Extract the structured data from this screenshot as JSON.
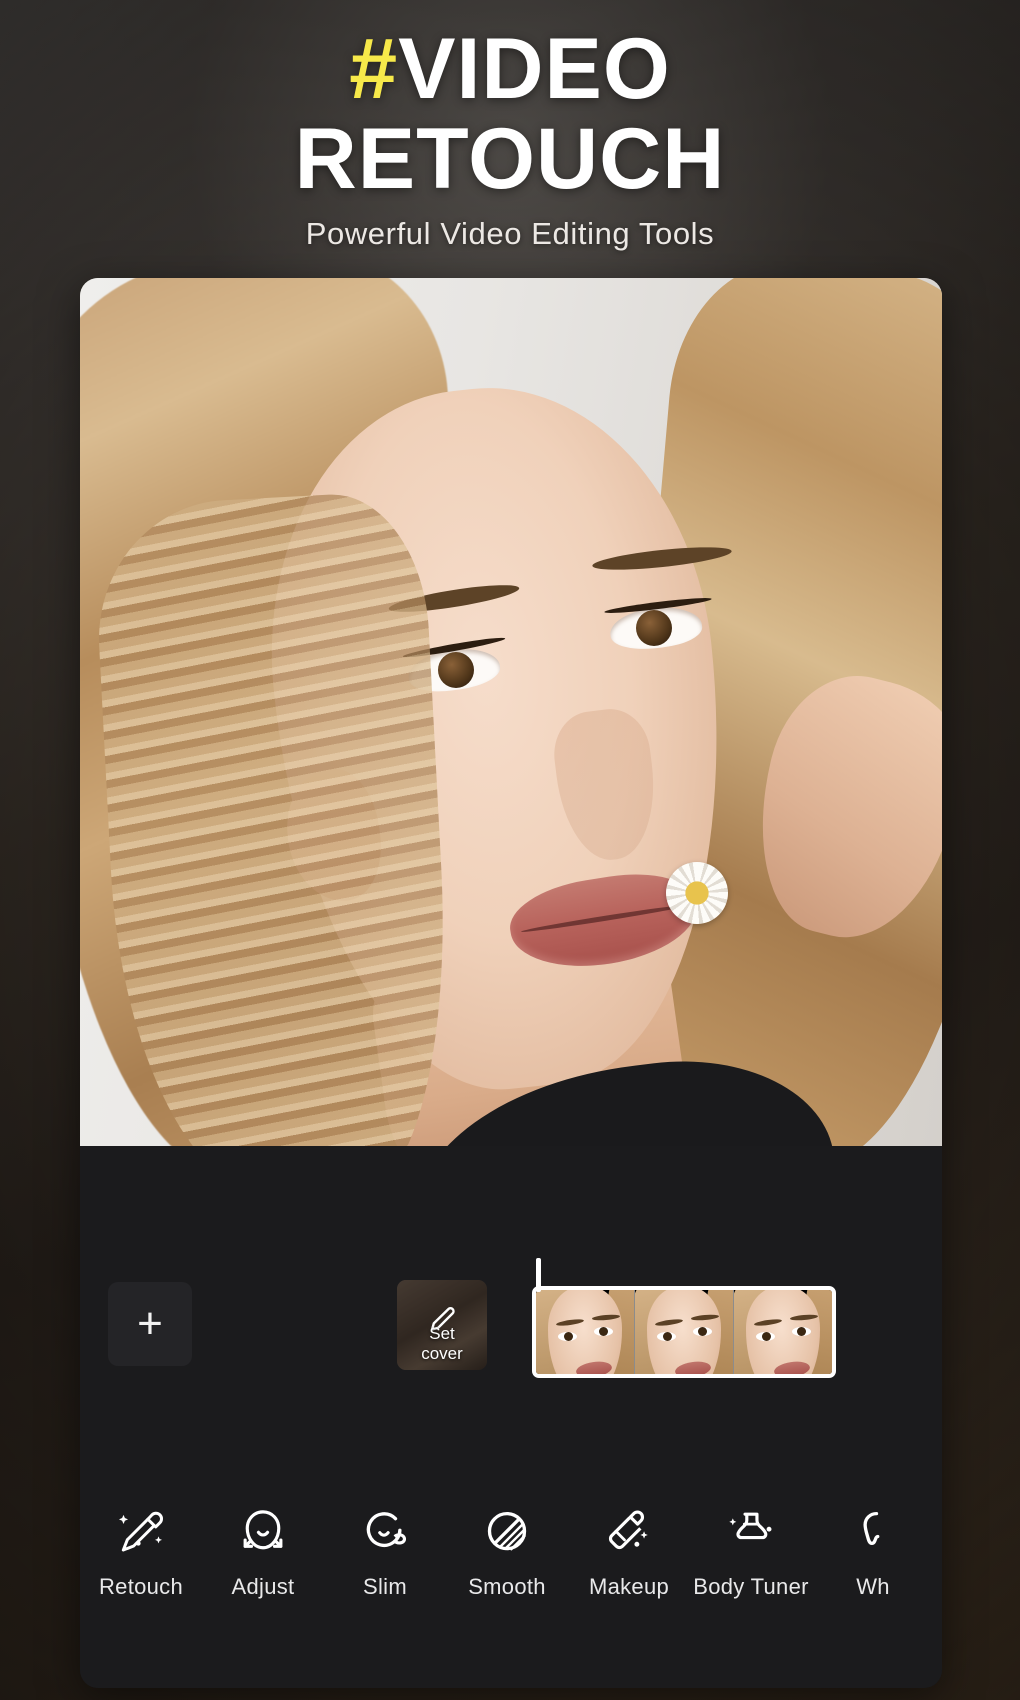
{
  "headline": {
    "hash": "#",
    "title_line1": "VIDEO",
    "title_line2": "RETOUCH",
    "subtitle": "Powerful Video Editing Tools",
    "accent_color": "#f7e94a",
    "text_color": "#ffffff"
  },
  "app": {
    "panel_bg": "#1b1b1d",
    "timeline": {
      "add_clip_label": "+",
      "set_cover": {
        "line1": "Set",
        "line2": "cover",
        "icon": "pencil-icon"
      },
      "clip_frames": 3,
      "playhead_position": "start"
    },
    "tools": [
      {
        "label": "Retouch",
        "icon": "magic-wand-icon"
      },
      {
        "label": "Adjust",
        "icon": "face-adjust-icon"
      },
      {
        "label": "Slim",
        "icon": "face-slim-icon"
      },
      {
        "label": "Smooth",
        "icon": "smooth-circle-icon"
      },
      {
        "label": "Makeup",
        "icon": "lipstick-icon"
      },
      {
        "label": "Body Tuner",
        "icon": "body-tuner-icon"
      },
      {
        "label": "Wh",
        "icon": "whiten-icon"
      }
    ]
  }
}
